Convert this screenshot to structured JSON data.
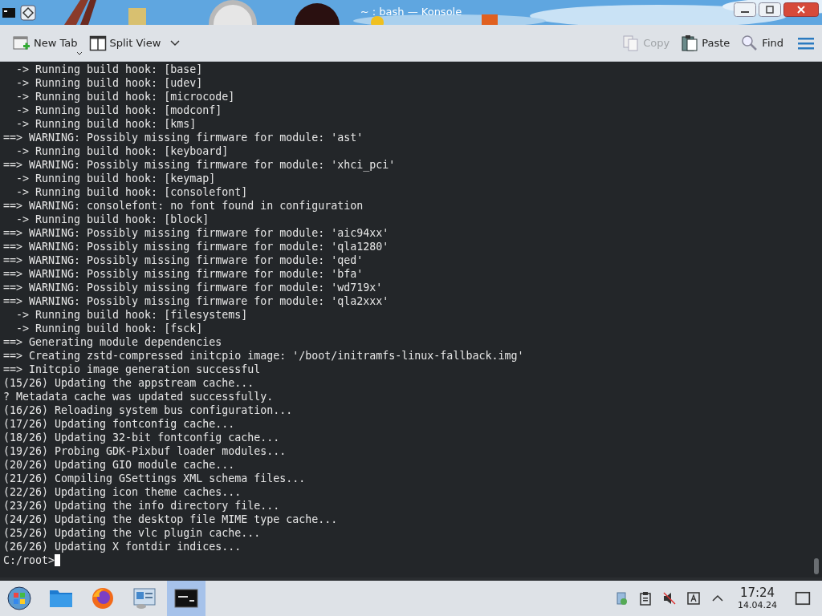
{
  "window": {
    "title": "~ : bash — Konsole"
  },
  "toolbar": {
    "buttons": [
      {
        "kind": "new-tab",
        "label": "New Tab",
        "disabled": false
      },
      {
        "kind": "split-view",
        "label": "Split View",
        "disabled": false
      },
      {
        "kind": "copy",
        "label": "Copy",
        "disabled": true
      },
      {
        "kind": "paste",
        "label": "Paste",
        "disabled": false
      },
      {
        "kind": "find",
        "label": "Find",
        "disabled": false
      }
    ]
  },
  "terminal": {
    "lines": [
      "  -> Running build hook: [base]",
      "  -> Running build hook: [udev]",
      "  -> Running build hook: [microcode]",
      "  -> Running build hook: [modconf]",
      "  -> Running build hook: [kms]",
      "==> WARNING: Possibly missing firmware for module: 'ast'",
      "  -> Running build hook: [keyboard]",
      "==> WARNING: Possibly missing firmware for module: 'xhci_pci'",
      "  -> Running build hook: [keymap]",
      "  -> Running build hook: [consolefont]",
      "==> WARNING: consolefont: no font found in configuration",
      "  -> Running build hook: [block]",
      "==> WARNING: Possibly missing firmware for module: 'aic94xx'",
      "==> WARNING: Possibly missing firmware for module: 'qla1280'",
      "==> WARNING: Possibly missing firmware for module: 'qed'",
      "==> WARNING: Possibly missing firmware for module: 'bfa'",
      "==> WARNING: Possibly missing firmware for module: 'wd719x'",
      "==> WARNING: Possibly missing firmware for module: 'qla2xxx'",
      "  -> Running build hook: [filesystems]",
      "  -> Running build hook: [fsck]",
      "==> Generating module dependencies",
      "==> Creating zstd-compressed initcpio image: '/boot/initramfs-linux-fallback.img'",
      "==> Initcpio image generation successful",
      "(15/26) Updating the appstream cache...",
      "? Metadata cache was updated successfully.",
      "(16/26) Reloading system bus configuration...",
      "(17/26) Updating fontconfig cache...",
      "(18/26) Updating 32-bit fontconfig cache...",
      "(19/26) Probing GDK-Pixbuf loader modules...",
      "(20/26) Updating GIO module cache...",
      "(21/26) Compiling GSettings XML schema files...",
      "(22/26) Updating icon theme caches...",
      "(23/26) Updating the info directory file...",
      "(24/26) Updating the desktop file MIME type cache...",
      "(25/26) Updating the vlc plugin cache...",
      "(26/26) Updating X fontdir indices..."
    ],
    "prompt": "C:/root>"
  },
  "taskbar": {
    "apps": [
      {
        "kind": "start",
        "selected": false
      },
      {
        "kind": "files",
        "selected": false
      },
      {
        "kind": "browser",
        "selected": false
      },
      {
        "kind": "system",
        "selected": false
      },
      {
        "kind": "terminal",
        "selected": true
      }
    ],
    "clock": {
      "time": "17:24",
      "date": "14.04.24"
    }
  }
}
